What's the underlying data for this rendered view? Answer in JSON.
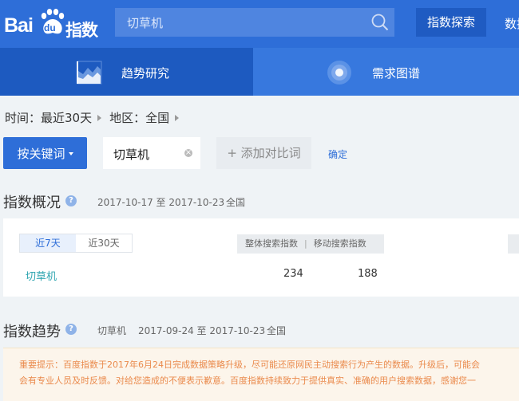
{
  "header": {
    "logo": {
      "bai": "Bai",
      "du": "du",
      "brand": "指数"
    },
    "search": {
      "value": "切草机"
    },
    "explore_label": "指数探索",
    "nav_more": "数据"
  },
  "tabs": [
    {
      "label": "趋势研究",
      "active": true
    },
    {
      "label": "需求图谱",
      "active": false
    }
  ],
  "filters": {
    "time": "时间：最近30天",
    "region": "地区：全国"
  },
  "keyword_bar": {
    "mode_label": "按关键词",
    "keyword": "切草机",
    "add_compare_label": "+ 添加对比词",
    "confirm_label": "确定"
  },
  "overview": {
    "title": "指数概况",
    "date_range": "2017-10-17 至 2017-10-23",
    "region": "全国",
    "day_options": [
      "近7天",
      "近30天"
    ],
    "selected_day_option": "近7天",
    "columns": [
      "整体搜索指数",
      "移动搜索指数"
    ],
    "rows": [
      {
        "keyword": "切草机",
        "overall": "234",
        "mobile": "188"
      }
    ]
  },
  "trend": {
    "title": "指数趋势",
    "keyword": "切草机",
    "date_range": "2017-09-24 至 2017-10-23",
    "region": "全国"
  },
  "notice": {
    "line1": "重要提示：百度指数于2017年6月24日完成数据策略升级，尽可能还原网民主动搜索行为产生的数据。升级后，可能会",
    "line2": "会有专业人员及时反馈。对给您造成的不便表示歉意。百度指数持续致力于提供真实、准确的用户搜索数据，感谢您一"
  },
  "colors": {
    "primary": "#2e6ed8",
    "header_bg": "#2e6ed8",
    "active_tab_bg": "#1d5ac0",
    "notice_text": "#ea8a4c",
    "keyword_link": "#2ea5b0"
  }
}
